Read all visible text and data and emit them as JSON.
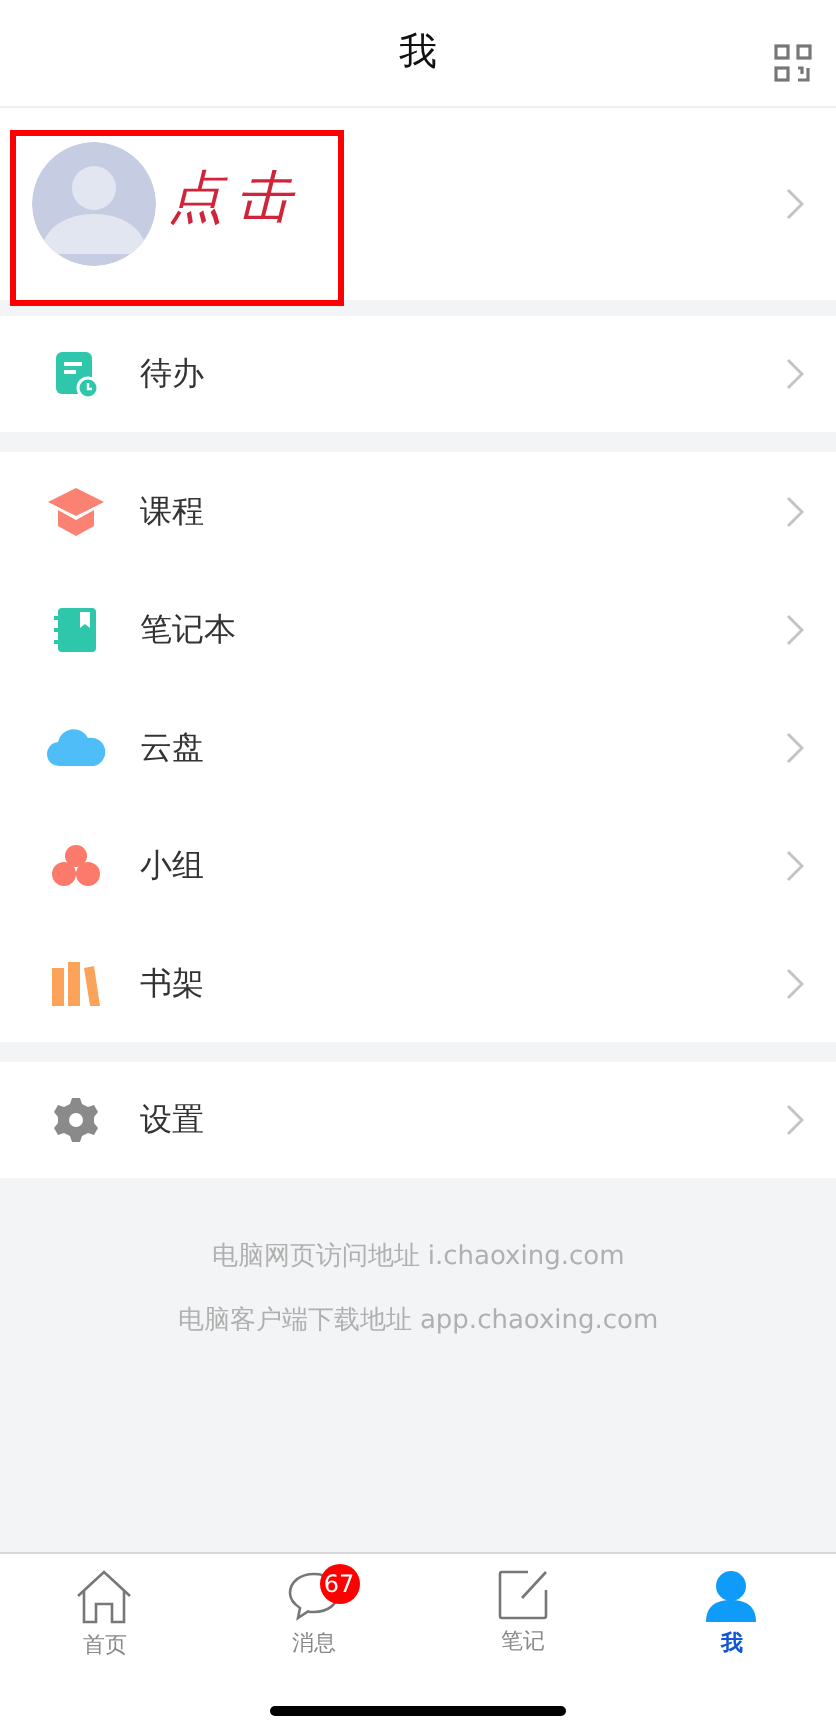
{
  "header": {
    "title": "我"
  },
  "profile": {
    "annotation": "点击"
  },
  "sections": [
    [
      {
        "label": "待办"
      }
    ],
    [
      {
        "label": "课程"
      },
      {
        "label": "笔记本"
      },
      {
        "label": "云盘"
      },
      {
        "label": "小组"
      },
      {
        "label": "书架"
      }
    ],
    [
      {
        "label": "设置"
      }
    ]
  ],
  "footer": [
    "电脑网页访问地址 i.chaoxing.com",
    "电脑客户端下载地址 app.chaoxing.com"
  ],
  "tab_bar": [
    {
      "label": "首页",
      "selected": false
    },
    {
      "label": "消息",
      "selected": false,
      "badge": "67"
    },
    {
      "label": "笔记",
      "selected": false
    },
    {
      "label": "我",
      "selected": true
    }
  ]
}
